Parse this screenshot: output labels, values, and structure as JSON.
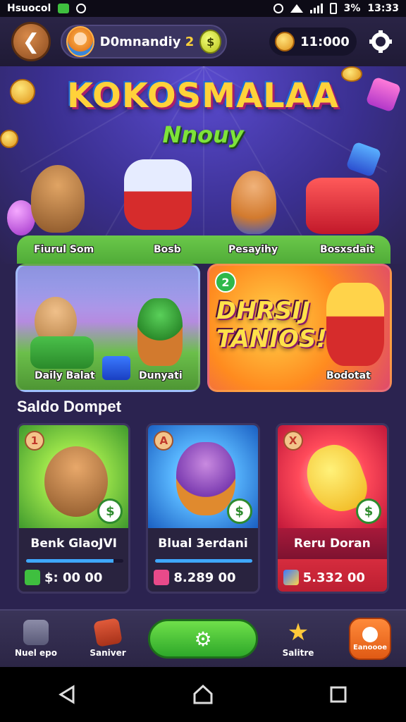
{
  "status_bar": {
    "carrier": "Hsuocol",
    "battery": "3%",
    "time": "13:33"
  },
  "header": {
    "back_icon": "arrow-left-icon",
    "player_name": "D0mnandiy",
    "player_level": "2",
    "coin_symbol": "$",
    "balance": "11:000",
    "settings_icon": "gear-icon"
  },
  "banner": {
    "title": "KOKOSMALAA",
    "subtitle": "Nnouy",
    "characters": [
      {
        "label": "Fiurul Som"
      },
      {
        "label": "Bosb"
      },
      {
        "label": "Pesayihy"
      },
      {
        "label": "Bosxsdait"
      }
    ]
  },
  "promos": {
    "left": {
      "label_1": "Daily Balat",
      "label_2": "Dunyati"
    },
    "right": {
      "badge": "2",
      "headline_1": "DHRSIJ",
      "headline_2": "TANIOS!",
      "label": "Bodotat"
    }
  },
  "wallet": {
    "section_title": "Saldo Dompet",
    "cards": [
      {
        "corner": "1",
        "name": "Benk GlaoJVI",
        "value": "$: 00 00",
        "progress": 0.9,
        "accent": "#3fa8ff"
      },
      {
        "corner": "A",
        "name": "Blual 3erdani",
        "value": "8.289 00",
        "progress": 1.0,
        "accent": "#3fa8ff"
      },
      {
        "corner": "X",
        "name": "Reru Doran",
        "value": "5.332 00",
        "progress": 0,
        "accent": "#d62c3e"
      }
    ]
  },
  "bottom_nav": {
    "items": [
      {
        "label": "Nuel epo",
        "icon": "home-icon"
      },
      {
        "label": "Saniver",
        "icon": "ticket-icon"
      },
      {
        "label": "",
        "icon": "play-icon"
      },
      {
        "label": "Salitre",
        "icon": "star-icon"
      },
      {
        "label": "Eanoooe",
        "icon": "profile-icon"
      }
    ]
  },
  "system_nav": {
    "back": "back-triangle-icon",
    "home": "home-circle-icon",
    "recents": "recents-square-icon"
  }
}
